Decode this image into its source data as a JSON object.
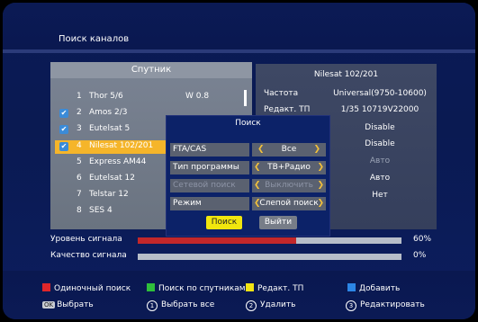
{
  "title": "Поиск каналов",
  "left_panel": {
    "header": "Спутник",
    "satellites": [
      {
        "num": "1",
        "name": "Thor 5/6",
        "checked": false,
        "selected": false
      },
      {
        "num": "2",
        "name": "Amos 2/3",
        "checked": true,
        "selected": false
      },
      {
        "num": "3",
        "name": "Eutelsat 5",
        "checked": true,
        "selected": false
      },
      {
        "num": "4",
        "name": "Nilesat 102/201",
        "checked": true,
        "selected": true
      },
      {
        "num": "5",
        "name": "Express AM44",
        "checked": false,
        "selected": false
      },
      {
        "num": "6",
        "name": "Eutelsat 12",
        "checked": false,
        "selected": false
      },
      {
        "num": "7",
        "name": "Telstar 12",
        "checked": false,
        "selected": false
      },
      {
        "num": "8",
        "name": "SES 4",
        "checked": false,
        "selected": false
      }
    ],
    "position_value": "W  0.8"
  },
  "right_panel": {
    "header": "Nilesat 102/201",
    "rows": [
      {
        "label": "Частота",
        "value": "Universal(9750-10600)"
      },
      {
        "label": "Редакт. ТП",
        "value": "1/35 10719V22000"
      },
      {
        "label": "",
        "value": "Disable"
      },
      {
        "label": "",
        "value": "Disable"
      },
      {
        "label": "",
        "value": "Авто"
      },
      {
        "label": "",
        "value": "Авто"
      },
      {
        "label": "",
        "value": "Нет"
      }
    ]
  },
  "dialog": {
    "title": "Поиск",
    "rows": [
      {
        "label": "FTA/CAS",
        "value": "Все",
        "enabled": true
      },
      {
        "label": "Тип программы",
        "value": "ТВ+Радио",
        "enabled": true
      },
      {
        "label": "Сетевой поиск",
        "value": "Выключить",
        "enabled": false
      },
      {
        "label": "Режим",
        "value": "Слепой поиск",
        "enabled": true
      }
    ],
    "search_button": "Поиск",
    "exit_button": "Выйти"
  },
  "signal": {
    "level_label": "Уровень сигнала",
    "level_pct": 60,
    "level_text": "60%",
    "quality_label": "Качество сигнала",
    "quality_pct": 0,
    "quality_text": "0%"
  },
  "footer": {
    "red_label": "Одиночный поиск",
    "green_label": "Поиск по спутникам",
    "yellow_label": "Редакт. ТП",
    "blue_label": "Добавить",
    "ok_key": "OK",
    "ok_label": "Выбрать",
    "key1": "1",
    "key1_label": "Выбрать все",
    "key2": "2",
    "key2_label": "Удалить",
    "key3": "3",
    "key3_label": "Редактировать"
  },
  "colors": {
    "red": "#e0262a",
    "green": "#2fbf3b",
    "yellow": "#f2e313",
    "blue": "#2c86e6",
    "selected_row": "#f5b52a",
    "signal_fill": "#c3272a"
  }
}
